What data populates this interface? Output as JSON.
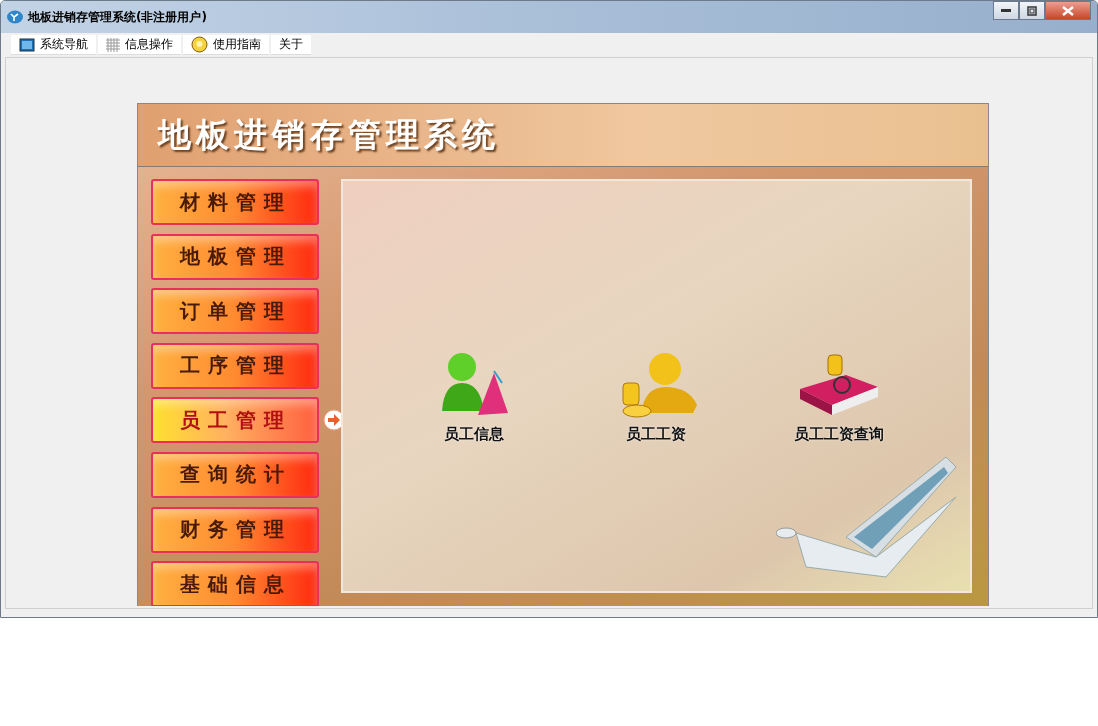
{
  "window": {
    "title": "地板进销存管理系统(非注册用户)"
  },
  "menu": [
    {
      "label": "系统导航",
      "kind": "monitor"
    },
    {
      "label": "信息操作",
      "kind": "grid"
    },
    {
      "label": "使用指南",
      "kind": "help"
    },
    {
      "label": "关于",
      "kind": "none"
    }
  ],
  "banner": {
    "title": "地板进销存管理系统"
  },
  "sidebar": {
    "items": [
      {
        "label": "材料管理",
        "selected": false
      },
      {
        "label": "地板管理",
        "selected": false
      },
      {
        "label": "订单管理",
        "selected": false
      },
      {
        "label": "工序管理",
        "selected": false
      },
      {
        "label": "员工管理",
        "selected": true
      },
      {
        "label": "查询统计",
        "selected": false
      },
      {
        "label": "财务管理",
        "selected": false
      },
      {
        "label": "基础信息",
        "selected": false
      }
    ]
  },
  "functions": [
    {
      "label": "员工信息",
      "kind": "person"
    },
    {
      "label": "员工工资",
      "kind": "salary"
    },
    {
      "label": "员工工资查询",
      "kind": "book"
    }
  ]
}
